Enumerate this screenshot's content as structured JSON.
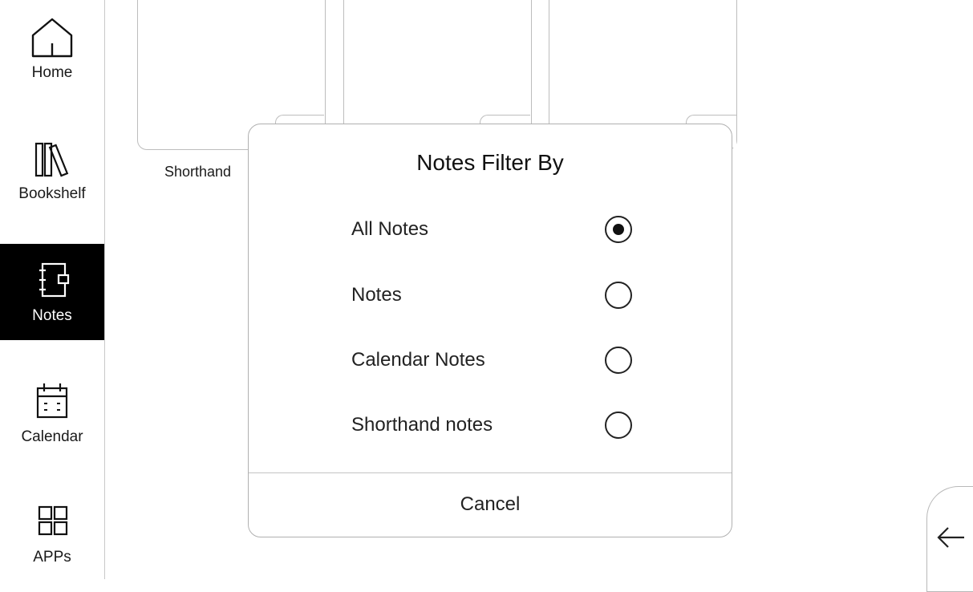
{
  "sidebar": {
    "items": [
      {
        "label": "Home",
        "icon": "home-icon",
        "active": false
      },
      {
        "label": "Bookshelf",
        "icon": "bookshelf-icon",
        "active": false
      },
      {
        "label": "Notes",
        "icon": "notebook-icon",
        "active": true
      },
      {
        "label": "Calendar",
        "icon": "calendar-icon",
        "active": false
      },
      {
        "label": "APPs",
        "icon": "apps-grid-icon",
        "active": false
      }
    ]
  },
  "background": {
    "cards": [
      {
        "caption": "Shorthand"
      }
    ]
  },
  "dialog": {
    "title": "Notes Filter By",
    "options": [
      {
        "label": "All Notes",
        "selected": true
      },
      {
        "label": "Notes",
        "selected": false
      },
      {
        "label": "Calendar Notes",
        "selected": false
      },
      {
        "label": "Shorthand notes",
        "selected": false
      }
    ],
    "cancel_label": "Cancel"
  },
  "back_button": {
    "icon": "arrow-left-icon"
  }
}
